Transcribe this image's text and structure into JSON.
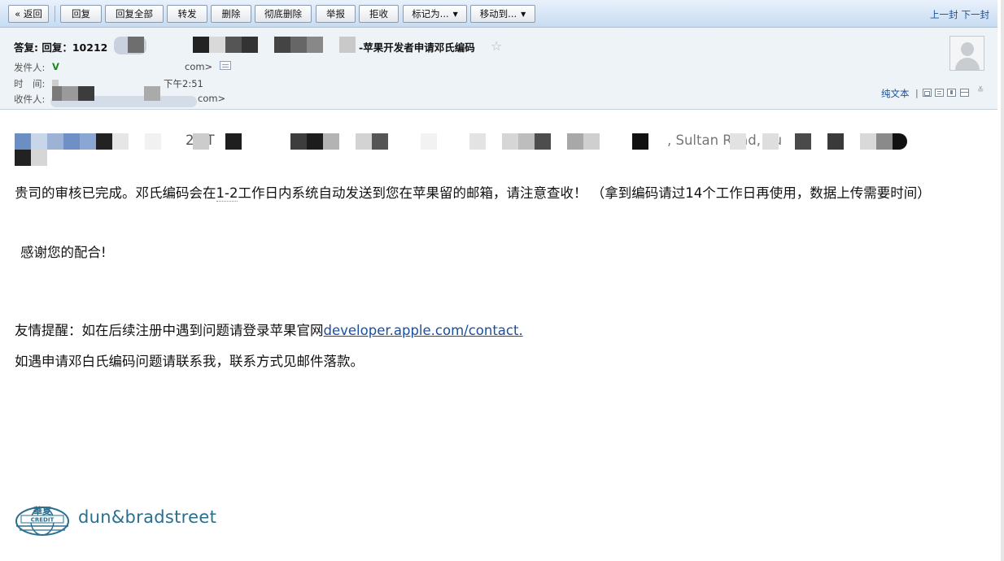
{
  "toolbar": {
    "back_label": "« 返回",
    "reply_label": "回复",
    "reply_all_label": "回复全部",
    "forward_label": "转发",
    "delete_label": "删除",
    "delete_permanent_label": "彻底删除",
    "report_label": "举报",
    "reject_label": "拒收",
    "mark_as_label": "标记为...",
    "move_to_label": "移动到...",
    "prev_label": "上一封",
    "next_label": "下一封"
  },
  "header": {
    "subject_prefix": "答复: 回复：10212",
    "subject_suffix": "-苹果开发者申请邓氏编码",
    "star_icon": "star-outline-icon",
    "from_label": "发件人:",
    "from_initial": "V",
    "from_domain": "com>",
    "time_label": "时　间:",
    "time_value": "下午2:51",
    "to_label": "收件人:",
    "to_domain": "com>",
    "plain_text_label": "纯文本"
  },
  "body": {
    "first_line_partial_1": "2 ' T",
    "first_line_partial_2": "g",
    "first_line_partial_3": ", Sultan Road, Su",
    "first_line_partial_4": "g",
    "review_text_a": "贵司的审核已完成。邓氏编码会在",
    "review_text_b": "1-2",
    "review_text_c": "工作日内系统自动发送到您在苹果留的邮箱，请注意查收！ （拿到编码请过14个工作日再使用，数据上传需要时间）",
    "thanks": "感谢您的配合!",
    "reminder_prefix": "友情提醒：如在后续注册中遇到问题请登录苹果官网",
    "reminder_link": "developer.apple.com/contact.",
    "contact_note": "如遇申请邓白氏编码问题请联系我，联系方式见邮件落款。"
  },
  "signature": {
    "logo_cn": "華夏",
    "logo_en": "CREDIT",
    "brand": "dun&bradstreet"
  },
  "colors": {
    "toolbar_bg": "#c7dcf2",
    "header_bg": "#eef3f8",
    "link": "#1a4fa0",
    "brand": "#2a6f8e"
  }
}
